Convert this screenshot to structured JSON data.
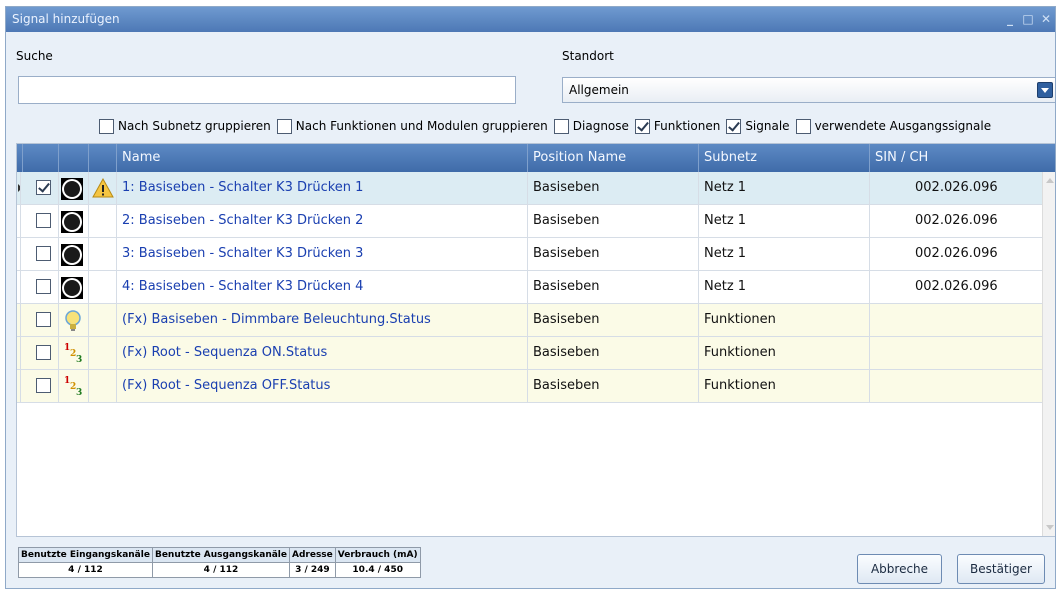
{
  "window": {
    "title": "Signal hinzufügen",
    "minimize": "_",
    "maximize": "□",
    "close": "✕"
  },
  "search": {
    "label": "Suche",
    "value": "",
    "placeholder": ""
  },
  "location": {
    "label": "Standort",
    "value": "Allgemein"
  },
  "filters": [
    {
      "label": "Nach Subnetz gruppieren",
      "checked": false
    },
    {
      "label": "Nach Funktionen und Modulen gruppieren",
      "checked": false
    },
    {
      "label": "Diagnose",
      "checked": false
    },
    {
      "label": "Funktionen",
      "checked": true
    },
    {
      "label": "Signale",
      "checked": true
    },
    {
      "label": "verwendete Ausgangssignale",
      "checked": false
    }
  ],
  "grid": {
    "columns": [
      "Name",
      "Position Name",
      "Subnetz",
      "SIN / CH"
    ],
    "rows": [
      {
        "name": "1: Basiseben - Schalter K3 Drücken 1",
        "position": "Basiseben",
        "subnet": "Netz 1",
        "sin": "002.026.096",
        "checked": true,
        "icon": "switch-icon",
        "warning": true
      },
      {
        "name": "2: Basiseben - Schalter K3 Drücken 2",
        "position": "Basiseben",
        "subnet": "Netz 1",
        "sin": "002.026.096",
        "checked": false,
        "icon": "switch-icon",
        "warning": false
      },
      {
        "name": "3: Basiseben - Schalter K3 Drücken 3",
        "position": "Basiseben",
        "subnet": "Netz 1",
        "sin": "002.026.096",
        "checked": false,
        "icon": "switch-icon",
        "warning": false
      },
      {
        "name": "4: Basiseben - Schalter K3 Drücken 4",
        "position": "Basiseben",
        "subnet": "Netz 1",
        "sin": "002.026.096",
        "checked": false,
        "icon": "switch-icon",
        "warning": false
      },
      {
        "name": "(Fx) Basiseben - Dimmbare Beleuchtung.Status",
        "position": "Basiseben",
        "subnet": "Funktionen",
        "sin": "",
        "checked": false,
        "icon": "bulb-icon",
        "warning": false
      },
      {
        "name": "(Fx) Root - Sequenza ON.Status",
        "position": "Basiseben",
        "subnet": "Funktionen",
        "sin": "",
        "checked": false,
        "icon": "sequence-icon",
        "warning": false
      },
      {
        "name": "(Fx) Root - Sequenza OFF.Status",
        "position": "Basiseben",
        "subnet": "Funktionen",
        "sin": "",
        "checked": false,
        "icon": "sequence-icon",
        "warning": false
      }
    ]
  },
  "stats": {
    "headers": [
      "Benutzte Eingangskanäle",
      "Benutzte Ausgangskanäle",
      "Adresse",
      "Verbrauch (mA)"
    ],
    "values": [
      "4 / 112",
      "4 / 112",
      "3 / 249",
      "10.4 / 450"
    ]
  },
  "buttons": {
    "cancel": "Abbreche",
    "confirm": "Bestätiger"
  },
  "colors": {
    "title_bar": "#5a86c2",
    "header": "#4a76b3",
    "link_text": "#1a3fb0",
    "selected_row": "#dcecf3",
    "function_row": "#fbfbe7"
  }
}
